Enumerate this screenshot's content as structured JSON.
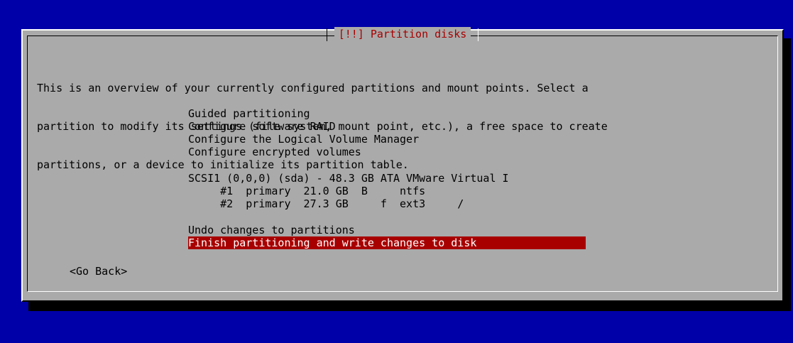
{
  "dialog": {
    "title": "[!!] Partition disks",
    "intro_lines": [
      "This is an overview of your currently configured partitions and mount points. Select a",
      "partition to modify its settings (file system, mount point, etc.), a free space to create",
      "partitions, or a device to initialize its partition table."
    ]
  },
  "menu": {
    "items": [
      "Guided partitioning",
      "Configure software RAID",
      "Configure the Logical Volume Manager",
      "Configure encrypted volumes",
      "SCSI1 (0,0,0) (sda) - 48.3 GB ATA VMware Virtual I",
      "     #1  primary  21.0 GB  B     ntfs",
      "     #2  primary  27.3 GB     f  ext3     /",
      "Undo changes to partitions",
      "Finish partitioning and write changes to disk"
    ],
    "selected_index": 8
  },
  "buttons": {
    "go_back": "<Go Back>"
  },
  "colors": {
    "background": "#0000a8",
    "dialog": "#aaaaaa",
    "title": "#a80000",
    "selection": "#a80000",
    "selection_text": "#ffffff"
  }
}
